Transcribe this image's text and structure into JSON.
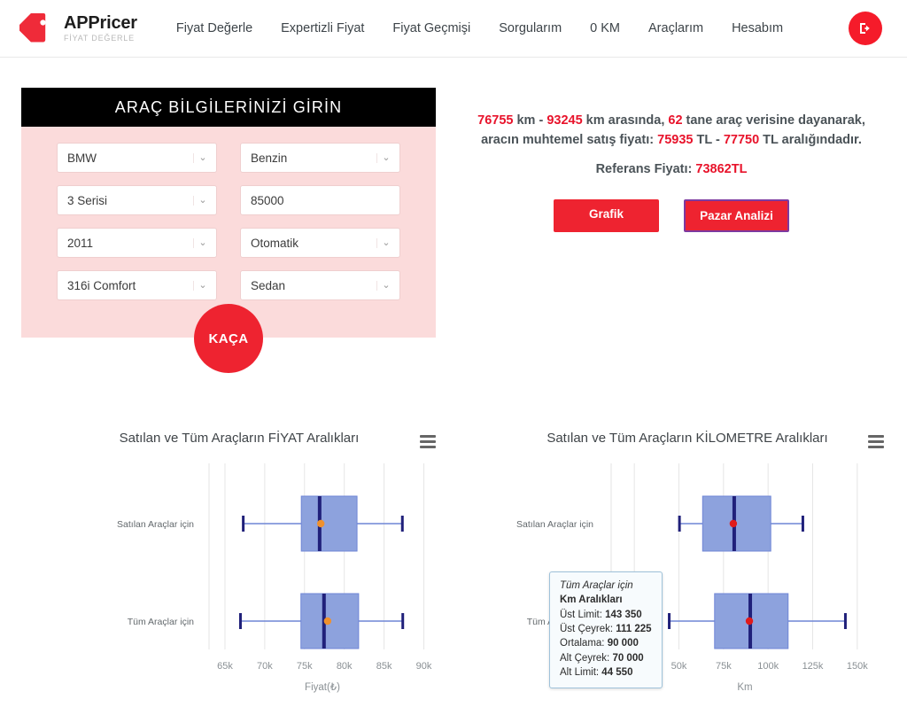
{
  "header": {
    "brand_name": "APPricer",
    "brand_sub": "FİYAT DEĞERLE",
    "logo_icon": "price-tag-icon",
    "logout_icon": "logout-icon",
    "nav": [
      {
        "label": "Fiyat Değerle"
      },
      {
        "label": "Expertizli Fiyat"
      },
      {
        "label": "Fiyat Geçmişi"
      },
      {
        "label": "Sorgularım"
      },
      {
        "label": "0 KM"
      },
      {
        "label": "Araçlarım"
      },
      {
        "label": "Hesabım"
      }
    ]
  },
  "form": {
    "title": "ARAÇ BİLGİLERİNİZİ GİRİN",
    "submit_label": "KAÇA",
    "fields": [
      {
        "name": "brand",
        "value": "BMW",
        "type": "select",
        "caret": "chevron-down-icon"
      },
      {
        "name": "fuel",
        "value": "Benzin",
        "type": "select",
        "caret": "chevron-down-icon"
      },
      {
        "name": "series",
        "value": "3 Serisi",
        "type": "select",
        "caret": "chevron-down-icon"
      },
      {
        "name": "km",
        "value": "85000",
        "type": "input",
        "placeholder": "Km"
      },
      {
        "name": "year",
        "value": "2011",
        "type": "select",
        "caret": "chevron-down-icon"
      },
      {
        "name": "transmission",
        "value": "Otomatik",
        "type": "select",
        "caret": "chevron-down-icon"
      },
      {
        "name": "trim",
        "value": "316i Comfort",
        "type": "select",
        "caret": "chevron-down-icon"
      },
      {
        "name": "body",
        "value": "Sedan",
        "type": "select",
        "caret": "chevron-down-icon"
      }
    ]
  },
  "result": {
    "km_min": "76755",
    "km_max": "93245",
    "count": "62",
    "price_min": "75935",
    "price_max": "77750",
    "reference_price": "73862TL",
    "line1_a": "76755",
    "line1_b": " km - ",
    "line1_c": "93245",
    "line1_d": " km arasında, ",
    "line1_e": "62",
    "line1_f": " tane araç verisine dayanarak,",
    "line2_a": "aracın muhtemel satış fiyatı: ",
    "line2_b": "75935",
    "line2_c": " TL - ",
    "line2_d": "77750",
    "line2_e": " TL aralığındadır.",
    "line3_a": "Referans Fiyatı: ",
    "line3_b": "73862TL",
    "button_grafik": "Grafik",
    "button_pazar": "Pazar Analizi",
    "accent_color": "#e8132b",
    "button_color": "#ee2330",
    "pazar_border_color": "#7d3aa0"
  },
  "tooltip": {
    "title": "Tüm Araçlar için",
    "subtitle": "Km Aralıkları",
    "rows": [
      {
        "label": "Üst Limit: ",
        "value": "143 350"
      },
      {
        "label": "Üst Çeyrek: ",
        "value": "111 225"
      },
      {
        "label": "Ortalama: ",
        "value": "90 000"
      },
      {
        "label": "Alt Çeyrek: ",
        "value": "70 000"
      },
      {
        "label": "Alt Limit: ",
        "value": "44 550"
      }
    ]
  },
  "chart_data": [
    {
      "type": "box",
      "id": "fiyat-chart",
      "title": "Satılan ve Tüm Araçların FİYAT Aralıkları",
      "xlabel": "Fiyat(₺)",
      "ylabel": "",
      "xlim": [
        63000,
        91500
      ],
      "xticks": [
        65000,
        70000,
        75000,
        80000,
        85000,
        90000
      ],
      "xticklabels": [
        "65k",
        "70k",
        "75k",
        "80k",
        "85k",
        "90k"
      ],
      "categories": [
        "Satılan Araçlar için",
        "Tüm Araçlar için"
      ],
      "grid": true,
      "legend": false,
      "menu_icon": "hamburger-menu-icon",
      "box_fill": "#8da2dd",
      "box_line": "#20207a",
      "mean_color": "#f0912d",
      "whisker_color": "#6f86d6",
      "boxes": [
        {
          "name": "Satılan Araçlar için",
          "lower_limit": 67300,
          "lower_quartile": 74600,
          "median": 76900,
          "upper_quartile": 81600,
          "upper_limit": 87300,
          "mean": 77050
        },
        {
          "name": "Tüm Araçlar için",
          "lower_limit": 66950,
          "lower_quartile": 74550,
          "median": 77450,
          "upper_quartile": 81800,
          "upper_limit": 87350,
          "mean": 77900
        }
      ]
    },
    {
      "type": "box",
      "id": "kilometre-chart",
      "title": "Satılan ve Tüm Araçların KİLOMETRE Aralıkları",
      "xlabel": "Km",
      "ylabel": "",
      "xlim": [
        12000,
        162000
      ],
      "xticks": [
        25000,
        50000,
        75000,
        100000,
        125000,
        150000
      ],
      "xticklabels": [
        "25k",
        "50k",
        "75k",
        "100k",
        "125k",
        "150k"
      ],
      "categories": [
        "Satılan Araçlar için",
        "Tüm Araçlar için"
      ],
      "grid": true,
      "legend": false,
      "menu_icon": "hamburger-menu-icon",
      "box_fill": "#8da2dd",
      "box_line": "#20207a",
      "mean_color": "#e01b1b",
      "whisker_color": "#6f86d6",
      "boxes": [
        {
          "name": "Satılan Araçlar için",
          "lower_limit": 50300,
          "lower_quartile": 63300,
          "median": 81000,
          "upper_quartile": 101500,
          "upper_limit": 119500,
          "mean": 80500
        },
        {
          "name": "Tüm Araçlar için",
          "lower_limit": 44550,
          "lower_quartile": 70000,
          "median": 90000,
          "upper_quartile": 111225,
          "upper_limit": 143350,
          "mean": 89500
        }
      ]
    }
  ]
}
